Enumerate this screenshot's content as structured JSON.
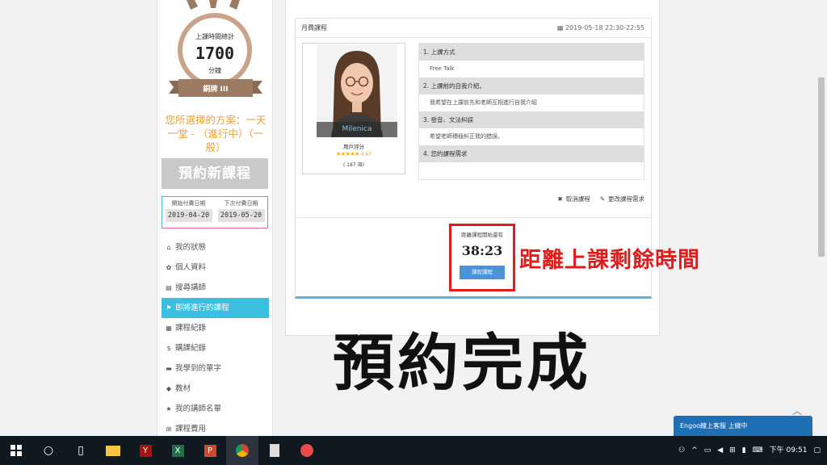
{
  "medal": {
    "title": "上課時間總計",
    "minutes": "1700",
    "unit": "分鐘",
    "rank": "銅牌 III"
  },
  "plan": {
    "text": "您所選擇的方案：一天一堂 - （進行中）（一般）"
  },
  "reserve_button": "預約新課程",
  "payment": {
    "start_label": "開始付費日期",
    "start_value": "2019-04-20",
    "next_label": "下次付費日期",
    "next_value": "2019-05-20"
  },
  "nav": [
    {
      "icon": "home-icon",
      "glyph": "⌂",
      "label": "我的狀態"
    },
    {
      "icon": "gear-icon",
      "glyph": "✿",
      "label": "個人資料"
    },
    {
      "icon": "book-icon",
      "glyph": "▤",
      "label": "搜尋講師"
    },
    {
      "icon": "flag-icon",
      "glyph": "⚑",
      "label": "即將進行的課程",
      "active": true
    },
    {
      "icon": "list-icon",
      "glyph": "▦",
      "label": "課程紀錄"
    },
    {
      "icon": "dollar-icon",
      "glyph": "$",
      "label": "購課紀錄"
    },
    {
      "icon": "folder-icon",
      "glyph": "▬",
      "label": "我學到的單字"
    },
    {
      "icon": "tag-icon",
      "glyph": "◆",
      "label": "教材"
    },
    {
      "icon": "star-icon",
      "glyph": "★",
      "label": "我的講師名單"
    },
    {
      "icon": "cart-icon",
      "glyph": "⊞",
      "label": "課程費用"
    }
  ],
  "lesson": {
    "type": "月費課程",
    "datetime": "2019-05-18 22:30-22:55",
    "teacher_name": "Milenica",
    "rating_label": "用戶評分",
    "rating_value": "4.67",
    "rating_fraction": 0.934,
    "reviews": "( 187 項)",
    "questions": [
      {
        "q": "1. 上課方式",
        "a": "Free Talk"
      },
      {
        "q": "2. 上課前的自我介紹。",
        "a": "我希望在上課前先和老師互相進行自我介紹"
      },
      {
        "q": "3. 發音、文法糾誤",
        "a": "希望老師積極糾正我的錯誤。"
      },
      {
        "q": "4. 您的課程需求",
        "a": ""
      }
    ],
    "cancel_label": "取消課程",
    "edit_label": "更改課程需求"
  },
  "countdown": {
    "label": "距離課程開始還有",
    "time": "38:23",
    "button": "課程課程"
  },
  "annotations": {
    "red_note": "距離上課剩餘時間",
    "big_text": "預約完成"
  },
  "chat": {
    "label": "Engoo線上客服 上線中"
  },
  "clock": {
    "time": "下午 09:51"
  },
  "colors": {
    "accent": "#3bbfe0",
    "highlight": "#e21d1d",
    "plan": "#e6a23c"
  }
}
